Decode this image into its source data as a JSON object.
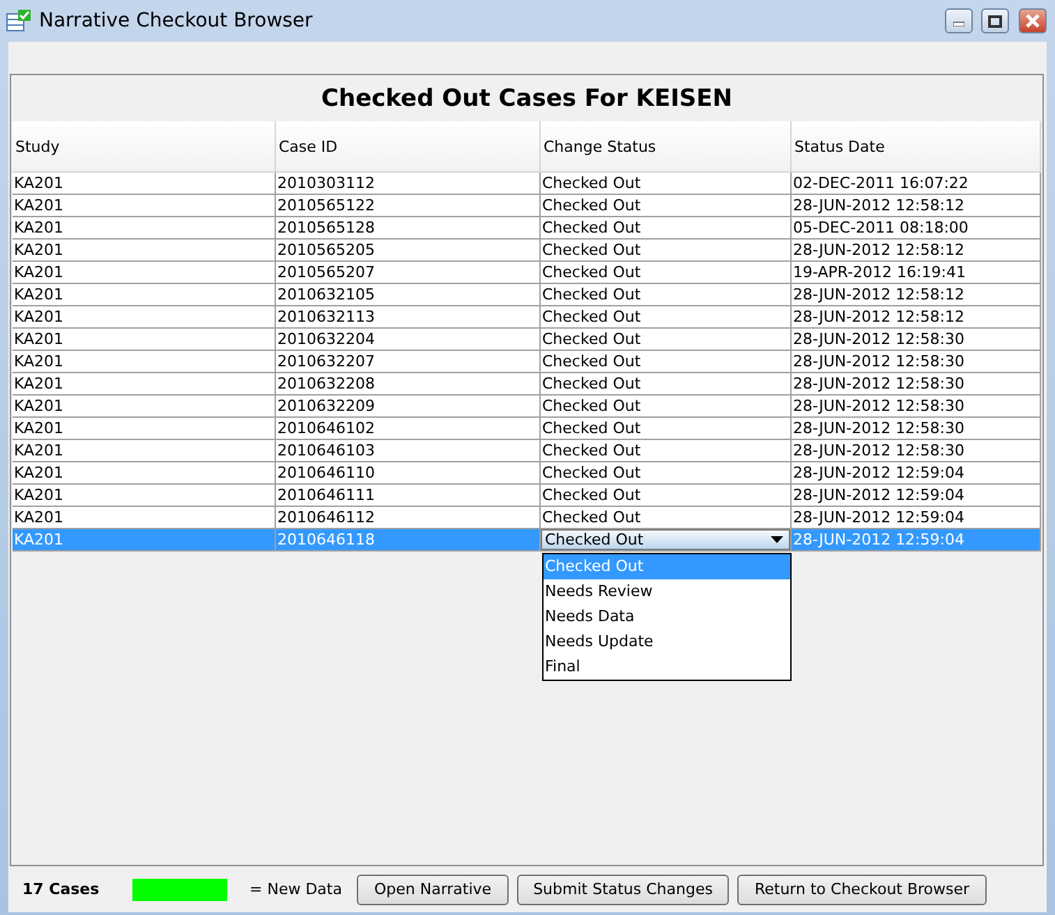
{
  "window": {
    "title": "Narrative Checkout Browser"
  },
  "panel": {
    "title": "Checked Out Cases For KEISEN"
  },
  "table": {
    "columns": [
      "Study",
      "Case ID",
      "Change Status",
      "Status Date"
    ],
    "rows": [
      {
        "cells": [
          "KA201",
          "2010303112",
          "Checked Out",
          "02-DEC-2011 16:07:22"
        ],
        "selected": false
      },
      {
        "cells": [
          "KA201",
          "2010565122",
          "Checked Out",
          "28-JUN-2012 12:58:12"
        ],
        "selected": false
      },
      {
        "cells": [
          "KA201",
          "2010565128",
          "Checked Out",
          "05-DEC-2011 08:18:00"
        ],
        "selected": false
      },
      {
        "cells": [
          "KA201",
          "2010565205",
          "Checked Out",
          "28-JUN-2012 12:58:12"
        ],
        "selected": false
      },
      {
        "cells": [
          "KA201",
          "2010565207",
          "Checked Out",
          "19-APR-2012 16:19:41"
        ],
        "selected": false
      },
      {
        "cells": [
          "KA201",
          "2010632105",
          "Checked Out",
          "28-JUN-2012 12:58:12"
        ],
        "selected": false
      },
      {
        "cells": [
          "KA201",
          "2010632113",
          "Checked Out",
          "28-JUN-2012 12:58:12"
        ],
        "selected": false
      },
      {
        "cells": [
          "KA201",
          "2010632204",
          "Checked Out",
          "28-JUN-2012 12:58:30"
        ],
        "selected": false
      },
      {
        "cells": [
          "KA201",
          "2010632207",
          "Checked Out",
          "28-JUN-2012 12:58:30"
        ],
        "selected": false
      },
      {
        "cells": [
          "KA201",
          "2010632208",
          "Checked Out",
          "28-JUN-2012 12:58:30"
        ],
        "selected": false
      },
      {
        "cells": [
          "KA201",
          "2010632209",
          "Checked Out",
          "28-JUN-2012 12:58:30"
        ],
        "selected": false
      },
      {
        "cells": [
          "KA201",
          "2010646102",
          "Checked Out",
          "28-JUN-2012 12:58:30"
        ],
        "selected": false
      },
      {
        "cells": [
          "KA201",
          "2010646103",
          "Checked Out",
          "28-JUN-2012 12:58:30"
        ],
        "selected": false
      },
      {
        "cells": [
          "KA201",
          "2010646110",
          "Checked Out",
          "28-JUN-2012 12:59:04"
        ],
        "selected": false
      },
      {
        "cells": [
          "KA201",
          "2010646111",
          "Checked Out",
          "28-JUN-2012 12:59:04"
        ],
        "selected": false
      },
      {
        "cells": [
          "KA201",
          "2010646112",
          "Checked Out",
          "28-JUN-2012 12:59:04"
        ],
        "selected": false
      },
      {
        "cells": [
          "KA201",
          "2010646118",
          "Checked Out",
          "28-JUN-2012 12:59:04"
        ],
        "selected": true
      }
    ],
    "dropdown": {
      "options": [
        {
          "label": "Checked Out",
          "selected": true
        },
        {
          "label": "Needs Review",
          "selected": false
        },
        {
          "label": "Needs Data",
          "selected": false
        },
        {
          "label": "Needs Update",
          "selected": false
        },
        {
          "label": "Final",
          "selected": false
        }
      ]
    }
  },
  "footer": {
    "count": "17 Cases",
    "legend": {
      "color": "#00ff00",
      "label": "= New Data"
    },
    "buttons": [
      "Open Narrative",
      "Submit Status Changes",
      "Return to Checkout Browser"
    ]
  }
}
